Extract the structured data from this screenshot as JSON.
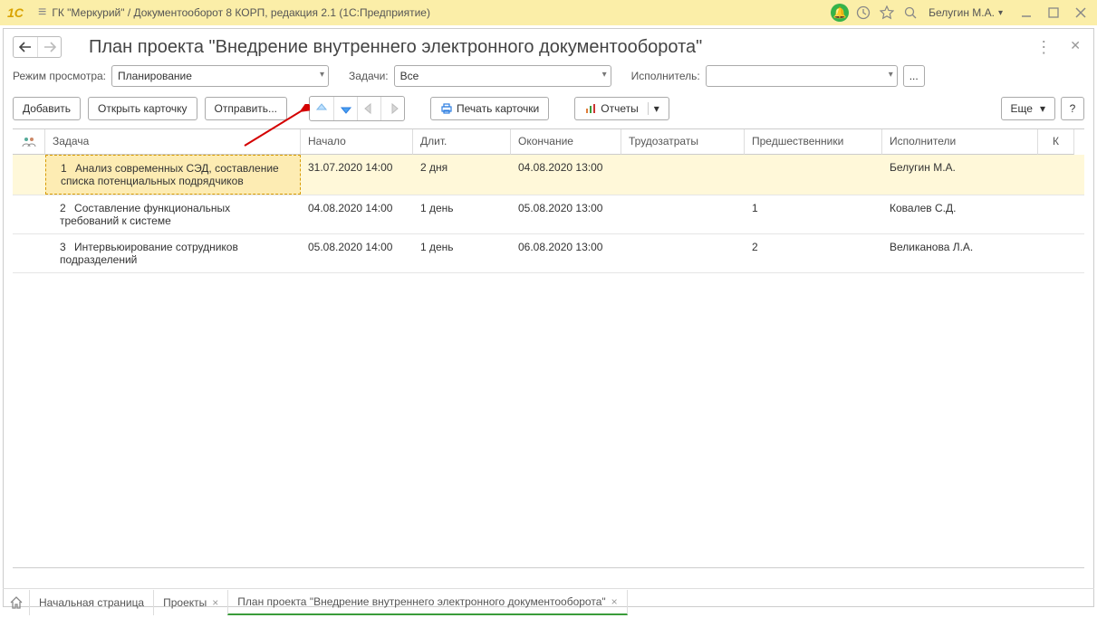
{
  "titlebar": {
    "app_title": "ГК \"Меркурий\" / Документооборот 8 КОРП, редакция 2.1  (1С:Предприятие)",
    "user": "Белугин М.А."
  },
  "page": {
    "title": "План проекта \"Внедрение внутреннего электронного документооборота\""
  },
  "filters": {
    "mode_label": "Режим просмотра:",
    "mode_value": "Планирование",
    "tasks_label": "Задачи:",
    "tasks_value": "Все",
    "executor_label": "Исполнитель:",
    "executor_value": "",
    "more_btn": "..."
  },
  "toolbar": {
    "add": "Добавить",
    "open_card": "Открыть карточку",
    "send": "Отправить...",
    "print_card": "Печать карточки",
    "reports": "Отчеты",
    "more": "Еще",
    "help": "?"
  },
  "table": {
    "headers": {
      "task": "Задача",
      "start": "Начало",
      "duration": "Длит.",
      "end": "Окончание",
      "labor": "Трудозатраты",
      "predecessors": "Предшественники",
      "executors": "Исполнители",
      "k": "К"
    },
    "rows": [
      {
        "num": "1",
        "task": "Анализ современных СЭД, составление списка потенциальных подрядчиков",
        "start": "31.07.2020 14:00",
        "duration": "2 дня",
        "end": "04.08.2020 13:00",
        "labor": "",
        "predecessors": "",
        "executors": "Белугин М.А.",
        "selected": true
      },
      {
        "num": "2",
        "task": "Составление функциональных требований к системе",
        "start": "04.08.2020 14:00",
        "duration": "1 день",
        "end": "05.08.2020 13:00",
        "labor": "",
        "predecessors": "1",
        "executors": "Ковалев С.Д.",
        "selected": false
      },
      {
        "num": "3",
        "task": "Интервьюирование сотрудников подразделений",
        "start": "05.08.2020 14:00",
        "duration": "1 день",
        "end": "06.08.2020 13:00",
        "labor": "",
        "predecessors": "2",
        "executors": "Великанова Л.А.",
        "selected": false
      }
    ]
  },
  "bottom_tabs": {
    "home": "Начальная страница",
    "projects": "Проекты",
    "plan": "План проекта \"Внедрение внутреннего электронного документооборота\""
  }
}
